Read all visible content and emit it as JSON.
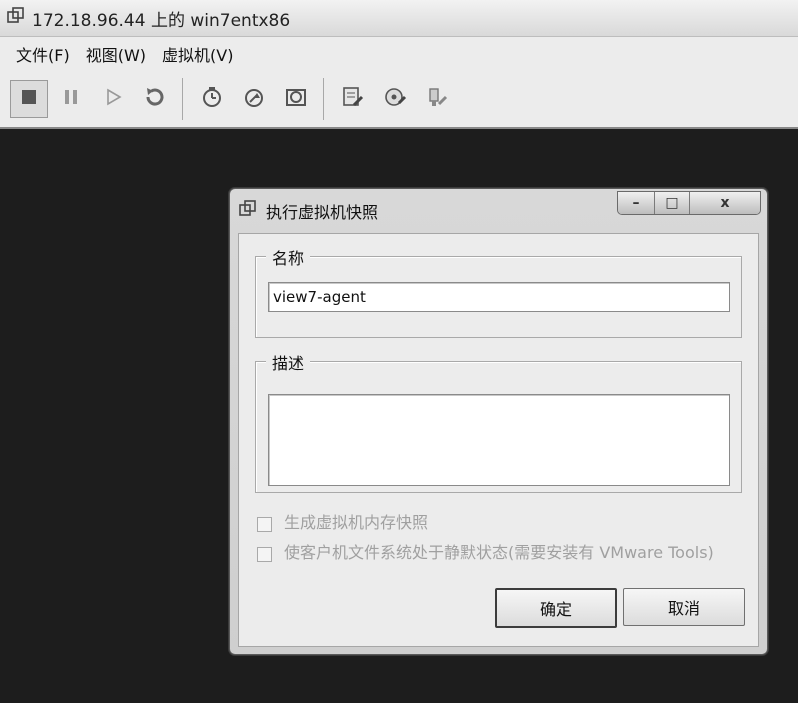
{
  "window": {
    "title": "172.18.96.44 上的 win7entx86"
  },
  "menu": {
    "items": [
      "文件(F)",
      "视图(W)",
      "虚拟机(V)"
    ]
  },
  "toolbar": {
    "buttons": [
      {
        "name": "power-off-icon"
      },
      {
        "name": "suspend-icon"
      },
      {
        "name": "power-on-icon"
      },
      {
        "name": "reset-icon"
      },
      {
        "name": "take-snapshot-icon"
      },
      {
        "name": "revert-snapshot-icon"
      },
      {
        "name": "snapshot-manager-icon"
      },
      {
        "name": "edit-settings-icon"
      },
      {
        "name": "connect-cd-icon"
      },
      {
        "name": "connect-usb-icon"
      }
    ]
  },
  "dialog": {
    "title": "执行虚拟机快照",
    "controls": {
      "minimize": "–",
      "maximize": "□",
      "close": "x"
    },
    "name_group": {
      "legend": "名称",
      "value": "view7-agent"
    },
    "description_group": {
      "legend": "描述",
      "value": ""
    },
    "options": [
      {
        "label": "生成虚拟机内存快照",
        "checked": false,
        "enabled": false
      },
      {
        "label": "使客户机文件系统处于静默状态(需要安装有 VMware Tools)",
        "checked": false,
        "enabled": false
      }
    ],
    "ok_label": "确定",
    "cancel_label": "取消"
  },
  "colors": {
    "background": "#1d1d1d",
    "chrome": "#ececec",
    "disabled_text": "#a0a0a0"
  }
}
